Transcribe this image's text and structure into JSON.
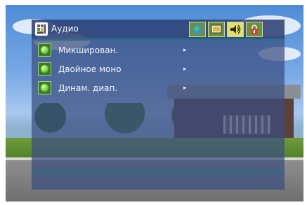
{
  "header": {
    "title": "Аудио",
    "app_icon": "menu-grid-icon"
  },
  "tabs": [
    {
      "icon": "globe-icon",
      "active": false
    },
    {
      "icon": "display-icon",
      "active": false
    },
    {
      "icon": "speaker-icon",
      "active": true
    },
    {
      "icon": "lock-icon",
      "active": false
    }
  ],
  "menu": {
    "items": [
      {
        "label": "Микширован.",
        "arrow": "▸"
      },
      {
        "label": "Двойное моно",
        "arrow": "▸"
      },
      {
        "label": "Динам. диап.",
        "arrow": "▸"
      }
    ]
  },
  "colors": {
    "overlay": "#3a4e80",
    "accent_line": "#2f6c86",
    "active_tab": "#e3e06a",
    "bullet": "#6bd13a"
  }
}
